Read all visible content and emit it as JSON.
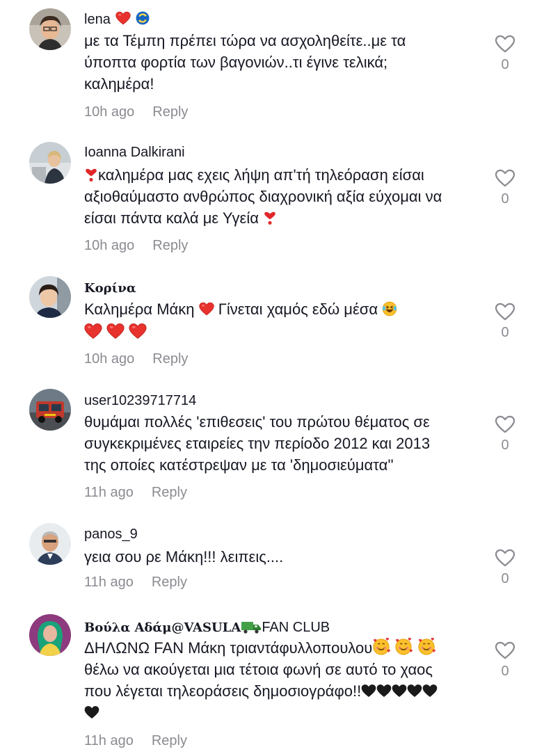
{
  "reply_label": "Reply",
  "comments": [
    {
      "username": "lena",
      "lines": [
        "με τα Τέμπη πρέπει τώρα να ασχοληθείτε..με τα",
        "ύποπτα φορτία των βαγονιών..τι έγινε τελικά;",
        "καλημέρα!"
      ],
      "time": "10h ago",
      "likes": "0"
    },
    {
      "username": "Ioanna Dalkirani",
      "lines": [
        "καλημέρα μας εχεις λήψη απ'τή τηλεόραση είσαι",
        "αξιοθαύμαστο ανθρώπος διαχρονική αξία εύχομαι να",
        "είσαι πάντα καλά με Υγεία"
      ],
      "time": "10h ago",
      "likes": "0"
    },
    {
      "username": "Κορίνα",
      "lines": [
        "Καλημέρα Μάκη",
        "Γίνεται χαμός εδώ μέσα"
      ],
      "time": "10h ago",
      "likes": "0"
    },
    {
      "username": "user10239717714",
      "lines": [
        "θυμάμαι πολλές 'επιθεσεις' του πρώτου θέματος σε",
        "συγκεκριμένες εταιρείες την περίοδο 2012 και 2013",
        "της οποίες κατέστρεψαν με τα 'δημοσιεύματα''"
      ],
      "time": "11h ago",
      "likes": "0"
    },
    {
      "username": "panos_9",
      "lines": [
        "γεια σου ρε Μάκη!!! λειπεις...."
      ],
      "time": "11h ago",
      "likes": "0"
    },
    {
      "username_part1": "Βούλα Αδάμ@VASULA",
      "username_part2": "FAN CLUB",
      "lines": [
        "ΔΗΛΩΝΩ FAN Μάκη τριαντάφυλλοπουλου",
        "θέλω να ακούγεται μια τέτοια φωνή σε αυτό το χαος",
        "που λέγεται τηλεοράσεις δημοσιογράφο!!"
      ],
      "time": "11h ago",
      "likes": "0"
    }
  ]
}
